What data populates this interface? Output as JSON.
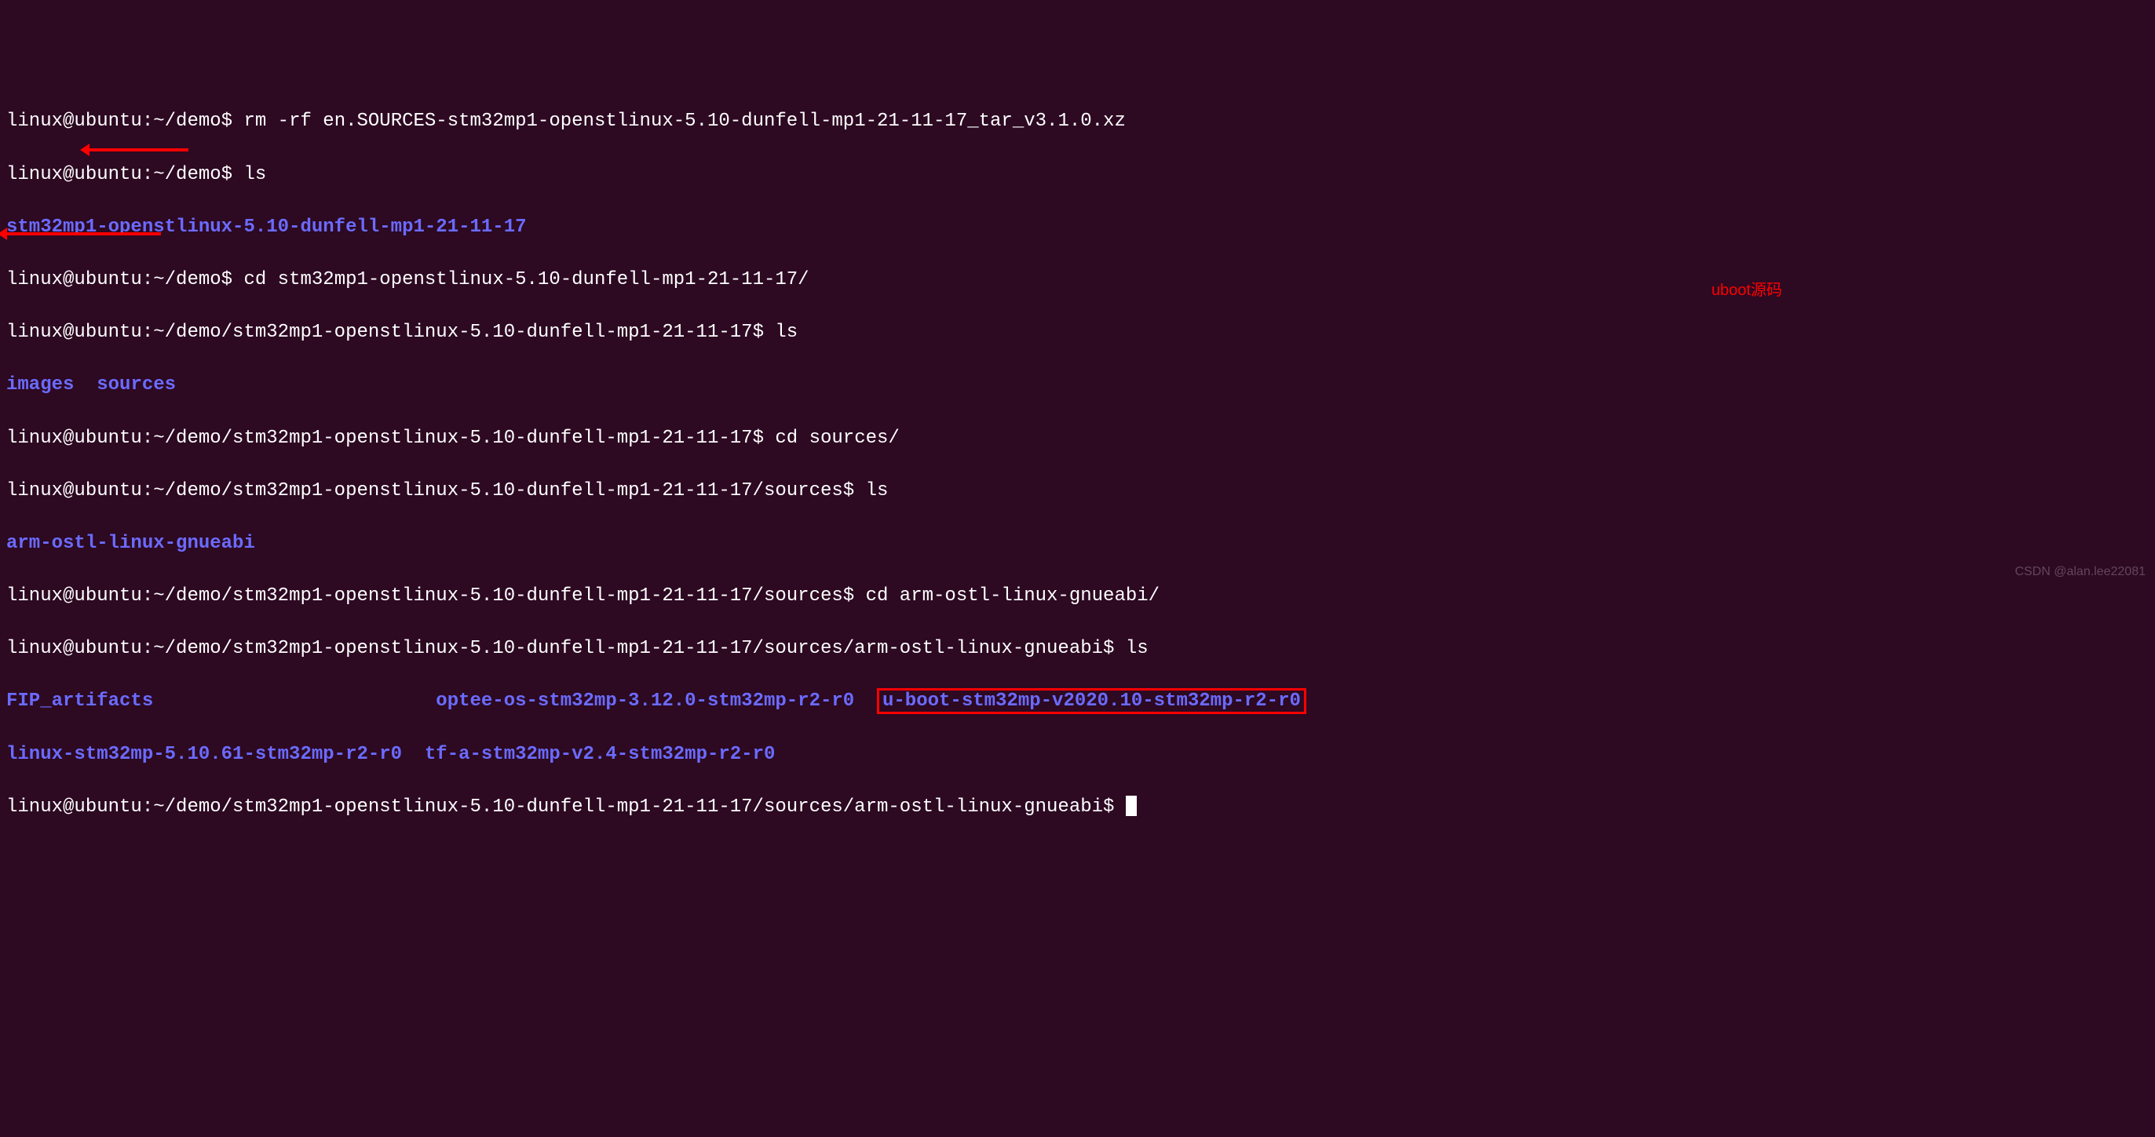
{
  "lines": {
    "l1": {
      "prompt_user": "linux@ubuntu",
      "prompt_sep": ":",
      "prompt_path": "~/demo",
      "prompt_dollar": "$ ",
      "cmd": "rm -rf en.SOURCES-stm32mp1-openstlinux-5.10-dunfell-mp1-21-11-17_tar_v3.1.0.xz"
    },
    "l2": {
      "prompt_user": "linux@ubuntu",
      "prompt_sep": ":",
      "prompt_path": "~/demo",
      "prompt_dollar": "$ ",
      "cmd": "ls"
    },
    "l3": {
      "dir": "stm32mp1-openstlinux-5.10-dunfell-mp1-21-11-17"
    },
    "l4": {
      "prompt_user": "linux@ubuntu",
      "prompt_sep": ":",
      "prompt_path": "~/demo",
      "prompt_dollar": "$ ",
      "cmd": "cd stm32mp1-openstlinux-5.10-dunfell-mp1-21-11-17/"
    },
    "l5": {
      "prompt_user": "linux@ubuntu",
      "prompt_sep": ":",
      "prompt_path": "~/demo/stm32mp1-openstlinux-5.10-dunfell-mp1-21-11-17",
      "prompt_dollar": "$ ",
      "cmd": "ls"
    },
    "l6": {
      "dir1": "images",
      "dir2": "sources"
    },
    "l7": {
      "prompt_user": "linux@ubuntu",
      "prompt_sep": ":",
      "prompt_path": "~/demo/stm32mp1-openstlinux-5.10-dunfell-mp1-21-11-17",
      "prompt_dollar": "$ ",
      "cmd": "cd sources/"
    },
    "l8": {
      "prompt_user": "linux@ubuntu",
      "prompt_sep": ":",
      "prompt_path": "~/demo/stm32mp1-openstlinux-5.10-dunfell-mp1-21-11-17/sources",
      "prompt_dollar": "$ ",
      "cmd": "ls"
    },
    "l9": {
      "dir": "arm-ostl-linux-gnueabi"
    },
    "l10": {
      "prompt_user": "linux@ubuntu",
      "prompt_sep": ":",
      "prompt_path": "~/demo/stm32mp1-openstlinux-5.10-dunfell-mp1-21-11-17/sources",
      "prompt_dollar": "$ ",
      "cmd": "cd arm-ostl-linux-gnueabi/"
    },
    "l11": {
      "prompt_user": "linux@ubuntu",
      "prompt_sep": ":",
      "prompt_path": "~/demo/stm32mp1-openstlinux-5.10-dunfell-mp1-21-11-17/sources/arm-ostl-linux-gnueabi",
      "prompt_dollar": "$ ",
      "cmd": "ls"
    },
    "l12": {
      "col1": "FIP_artifacts",
      "col2": "optee-os-stm32mp-3.12.0-stm32mp-r2-r0",
      "col3": "u-boot-stm32mp-v2020.10-stm32mp-r2-r0"
    },
    "l13": {
      "col1": "linux-stm32mp-5.10.61-stm32mp-r2-r0",
      "col2": "tf-a-stm32mp-v2.4-stm32mp-r2-r0"
    },
    "l14": {
      "prompt_user": "linux@ubuntu",
      "prompt_sep": ":",
      "prompt_path": "~/demo/stm32mp1-openstlinux-5.10-dunfell-mp1-21-11-17/sources/arm-ostl-linux-gnueabi",
      "prompt_dollar": "$ "
    }
  },
  "annotation": "uboot源码",
  "watermark": "CSDN @alan.lee22081"
}
